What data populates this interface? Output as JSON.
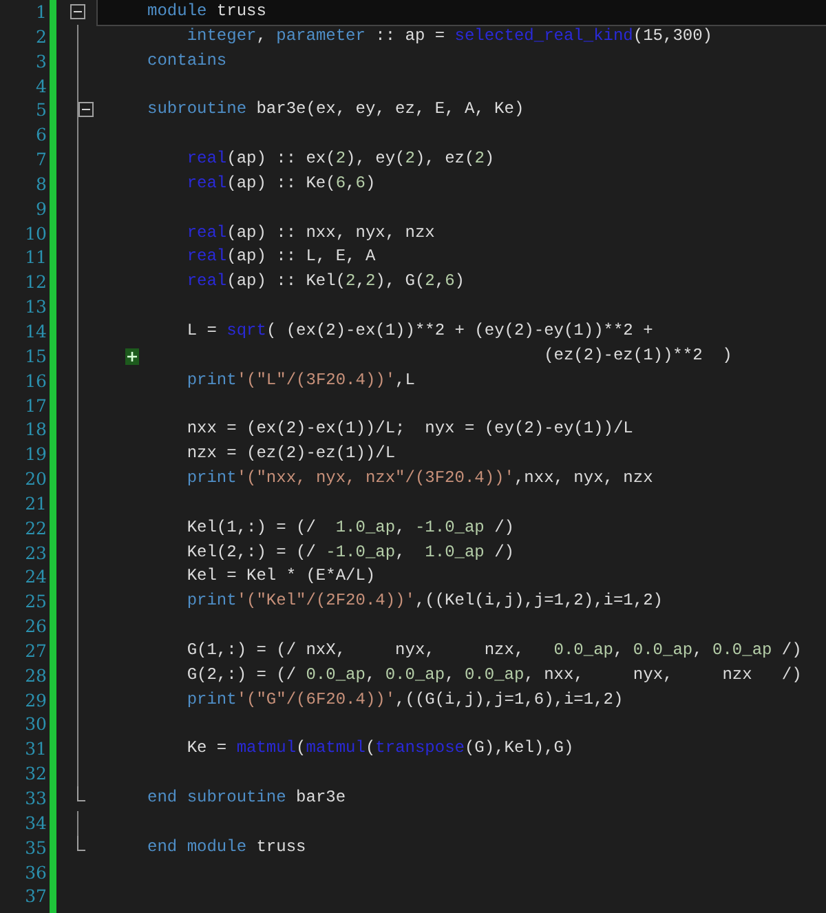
{
  "editor": {
    "lines": [
      {
        "number": "1",
        "current": true,
        "kind": "collapsible",
        "tokens": [
          {
            "kind": "keyword",
            "text": "    module"
          },
          {
            "kind": "plain",
            "text": " truss"
          }
        ]
      },
      {
        "number": "2",
        "current": false,
        "kind": "plain",
        "tokens": [
          {
            "kind": "keyword",
            "text": "        integer"
          },
          {
            "kind": "plain",
            "text": ", "
          },
          {
            "kind": "keyword",
            "text": "parameter"
          },
          {
            "kind": "plain",
            "text": " :: ap = "
          },
          {
            "kind": "intrinsic",
            "text": "selected_real_kind"
          },
          {
            "kind": "plain",
            "text": "(15,300)"
          }
        ]
      },
      {
        "number": "3",
        "current": false,
        "kind": "plain",
        "tokens": [
          {
            "kind": "keyword",
            "text": "    contains"
          }
        ]
      },
      {
        "number": "4",
        "current": false,
        "kind": "plain"
      },
      {
        "number": "5",
        "current": false,
        "kind": "collapsible",
        "tokens": [
          {
            "kind": "keyword",
            "text": "    subroutine"
          },
          {
            "kind": "plain",
            "text": " bar3e(ex, ey, ez, E, A, Ke)"
          }
        ]
      },
      {
        "number": "6",
        "current": false,
        "kind": "plain"
      },
      {
        "number": "7",
        "current": false,
        "kind": "plain",
        "tokens": [
          {
            "kind": "intrinsic",
            "text": "        real"
          },
          {
            "kind": "plain",
            "text": "(ap) :: ex("
          },
          {
            "kind": "number",
            "text": "2"
          },
          {
            "kind": "plain",
            "text": "), ey("
          },
          {
            "kind": "number",
            "text": "2"
          },
          {
            "kind": "plain",
            "text": "), ez("
          },
          {
            "kind": "number",
            "text": "2"
          },
          {
            "kind": "plain",
            "text": ")"
          }
        ]
      },
      {
        "number": "8",
        "current": false,
        "kind": "plain",
        "tokens": [
          {
            "kind": "intrinsic",
            "text": "        real"
          },
          {
            "kind": "plain",
            "text": "(ap) :: Ke("
          },
          {
            "kind": "number",
            "text": "6"
          },
          {
            "kind": "plain",
            "text": ","
          },
          {
            "kind": "number",
            "text": "6"
          },
          {
            "kind": "plain",
            "text": ")"
          }
        ]
      },
      {
        "number": "9",
        "current": false,
        "kind": "plain"
      },
      {
        "number": "10",
        "current": false,
        "kind": "plain",
        "tokens": [
          {
            "kind": "intrinsic",
            "text": "        real"
          },
          {
            "kind": "plain",
            "text": "(ap) :: nxx, nyx, nzx"
          }
        ]
      },
      {
        "number": "11",
        "current": false,
        "kind": "plain",
        "tokens": [
          {
            "kind": "intrinsic",
            "text": "        real"
          },
          {
            "kind": "plain",
            "text": "(ap) :: L, E, A"
          }
        ]
      },
      {
        "number": "12",
        "current": false,
        "kind": "plain",
        "tokens": [
          {
            "kind": "intrinsic",
            "text": "        real"
          },
          {
            "kind": "plain",
            "text": "(ap) :: Kel("
          },
          {
            "kind": "number",
            "text": "2"
          },
          {
            "kind": "plain",
            "text": ","
          },
          {
            "kind": "number",
            "text": "2"
          },
          {
            "kind": "plain",
            "text": "), G("
          },
          {
            "kind": "number",
            "text": "2"
          },
          {
            "kind": "plain",
            "text": ","
          },
          {
            "kind": "number",
            "text": "6"
          },
          {
            "kind": "plain",
            "text": ")"
          }
        ]
      },
      {
        "number": "13",
        "current": false,
        "kind": "plain"
      },
      {
        "number": "14",
        "current": false,
        "kind": "plain",
        "tokens": [
          {
            "kind": "plain",
            "text": "        L = "
          },
          {
            "kind": "intrinsic",
            "text": "sqrt"
          },
          {
            "kind": "plain",
            "text": "( (ex(2)-ex(1))**2 + (ey(2)-ey(1))**2 +"
          }
        ]
      },
      {
        "number": "15",
        "current": false,
        "kind": "added",
        "tokens": [
          {
            "kind": "plain",
            "text": "                                            (ez(2)-ez(1))**2  )"
          }
        ]
      },
      {
        "number": "16",
        "current": false,
        "kind": "plain",
        "tokens": [
          {
            "kind": "keyword",
            "text": "        print"
          },
          {
            "kind": "string",
            "text": "'(\"L\"/(3F20.4))'"
          },
          {
            "kind": "plain",
            "text": ",L"
          }
        ]
      },
      {
        "number": "17",
        "current": false,
        "kind": "plain"
      },
      {
        "number": "18",
        "current": false,
        "kind": "plain",
        "tokens": [
          {
            "kind": "plain",
            "text": "        nxx = (ex(2)-ex(1))/L;  nyx = (ey(2)-ey(1))/L"
          }
        ]
      },
      {
        "number": "19",
        "current": false,
        "kind": "plain",
        "tokens": [
          {
            "kind": "plain",
            "text": "        nzx = (ez(2)-ez(1))/L"
          }
        ]
      },
      {
        "number": "20",
        "current": false,
        "kind": "plain",
        "tokens": [
          {
            "kind": "keyword",
            "text": "        print"
          },
          {
            "kind": "string",
            "text": "'(\"nxx, nyx, nzx\"/(3F20.4))'"
          },
          {
            "kind": "plain",
            "text": ",nxx, nyx, nzx"
          }
        ]
      },
      {
        "number": "21",
        "current": false,
        "kind": "plain"
      },
      {
        "number": "22",
        "current": false,
        "kind": "plain",
        "tokens": [
          {
            "kind": "plain",
            "text": "        Kel(1,:) = (/  "
          },
          {
            "kind": "number",
            "text": "1.0_ap"
          },
          {
            "kind": "plain",
            "text": ", "
          },
          {
            "kind": "number",
            "text": "-1.0_ap"
          },
          {
            "kind": "plain",
            "text": " /)"
          }
        ]
      },
      {
        "number": "23",
        "current": false,
        "kind": "plain",
        "tokens": [
          {
            "kind": "plain",
            "text": "        Kel(2,:) = (/ "
          },
          {
            "kind": "number",
            "text": "-1.0_ap"
          },
          {
            "kind": "plain",
            "text": ",  "
          },
          {
            "kind": "number",
            "text": "1.0_ap"
          },
          {
            "kind": "plain",
            "text": " /)"
          }
        ]
      },
      {
        "number": "24",
        "current": false,
        "kind": "plain",
        "tokens": [
          {
            "kind": "plain",
            "text": "        Kel = Kel * (E*A/L)"
          }
        ]
      },
      {
        "number": "25",
        "current": false,
        "kind": "plain",
        "tokens": [
          {
            "kind": "keyword",
            "text": "        print"
          },
          {
            "kind": "string",
            "text": "'(\"Kel\"/(2F20.4))'"
          },
          {
            "kind": "plain",
            "text": ",((Kel(i,j),j=1,2),i=1,2)"
          }
        ]
      },
      {
        "number": "26",
        "current": false,
        "kind": "plain"
      },
      {
        "number": "27",
        "current": false,
        "kind": "plain",
        "tokens": [
          {
            "kind": "plain",
            "text": "        G(1,:) = (/ nxX,     nyx,     nzx,   "
          },
          {
            "kind": "number",
            "text": "0.0_ap"
          },
          {
            "kind": "plain",
            "text": ", "
          },
          {
            "kind": "number",
            "text": "0.0_ap"
          },
          {
            "kind": "plain",
            "text": ", "
          },
          {
            "kind": "number",
            "text": "0.0_ap"
          },
          {
            "kind": "plain",
            "text": " /)"
          }
        ]
      },
      {
        "number": "28",
        "current": false,
        "kind": "plain",
        "tokens": [
          {
            "kind": "plain",
            "text": "        G(2,:) = (/ "
          },
          {
            "kind": "number",
            "text": "0.0_ap"
          },
          {
            "kind": "plain",
            "text": ", "
          },
          {
            "kind": "number",
            "text": "0.0_ap"
          },
          {
            "kind": "plain",
            "text": ", "
          },
          {
            "kind": "number",
            "text": "0.0_ap"
          },
          {
            "kind": "plain",
            "text": ", nxx,     nyx,     nzx   /)"
          }
        ]
      },
      {
        "number": "29",
        "current": false,
        "kind": "plain",
        "tokens": [
          {
            "kind": "keyword",
            "text": "        print"
          },
          {
            "kind": "string",
            "text": "'(\"G\"/(6F20.4))'"
          },
          {
            "kind": "plain",
            "text": ",((G(i,j),j=1,6),i=1,2)"
          }
        ]
      },
      {
        "number": "30",
        "current": false,
        "kind": "plain"
      },
      {
        "number": "31",
        "current": false,
        "kind": "plain",
        "tokens": [
          {
            "kind": "plain",
            "text": "        Ke = "
          },
          {
            "kind": "intrinsic",
            "text": "matmul"
          },
          {
            "kind": "plain",
            "text": "("
          },
          {
            "kind": "intrinsic",
            "text": "matmul"
          },
          {
            "kind": "plain",
            "text": "("
          },
          {
            "kind": "intrinsic",
            "text": "transpose"
          },
          {
            "kind": "plain",
            "text": "(G),Kel),G)"
          }
        ]
      },
      {
        "number": "32",
        "current": false,
        "kind": "plain"
      },
      {
        "number": "33",
        "current": false,
        "kind": "blockend",
        "tokens": [
          {
            "kind": "keyword",
            "text": "    end subroutine"
          },
          {
            "kind": "plain",
            "text": " bar3e"
          }
        ]
      },
      {
        "number": "34",
        "current": false,
        "kind": "plain"
      },
      {
        "number": "35",
        "current": false,
        "kind": "blockend",
        "tokens": [
          {
            "kind": "keyword",
            "text": "    end module"
          },
          {
            "kind": "plain",
            "text": " truss"
          }
        ]
      },
      {
        "number": "36",
        "current": false,
        "kind": "plain"
      },
      {
        "number": "37",
        "current": false,
        "kind": "plain"
      }
    ]
  }
}
